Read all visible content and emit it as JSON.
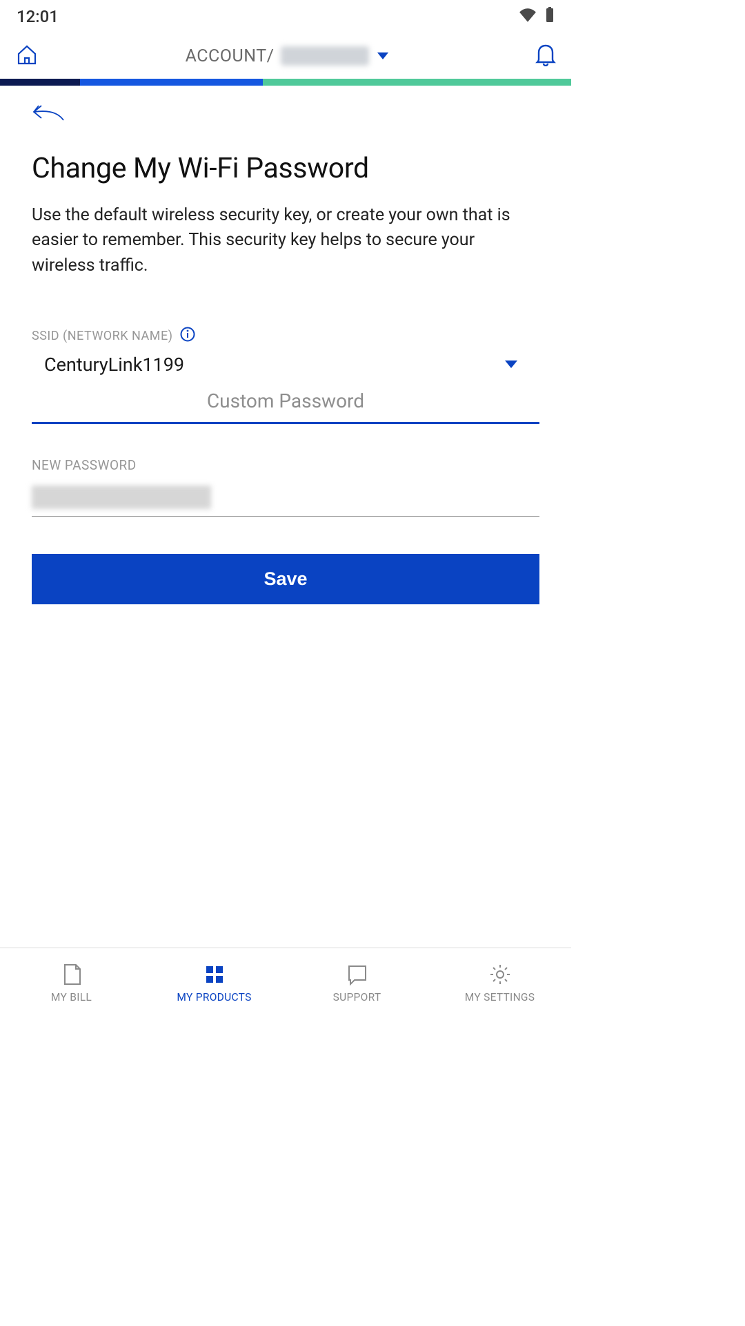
{
  "statusbar": {
    "time": "12:01"
  },
  "appbar": {
    "account_prefix": "ACCOUNT/"
  },
  "page": {
    "title": "Change My Wi-Fi Password",
    "description": "Use the default wireless security key, or create your own that is easier to remember. This security key helps to secure your wireless traffic.",
    "ssid_label": "SSID (NETWORK NAME)",
    "ssid_value": "CenturyLink1199",
    "custom_password_placeholder": "Custom Password",
    "new_password_label": "NEW PASSWORD",
    "save_label": "Save"
  },
  "bottomnav": {
    "items": [
      {
        "label": "MY BILL"
      },
      {
        "label": "MY PRODUCTS"
      },
      {
        "label": "SUPPORT"
      },
      {
        "label": "MY SETTINGS"
      }
    ],
    "active_index": 1
  },
  "colors": {
    "accent": "#0a43c2",
    "green": "#50c99a",
    "navy": "#0c1a52",
    "blue": "#1557e0"
  }
}
